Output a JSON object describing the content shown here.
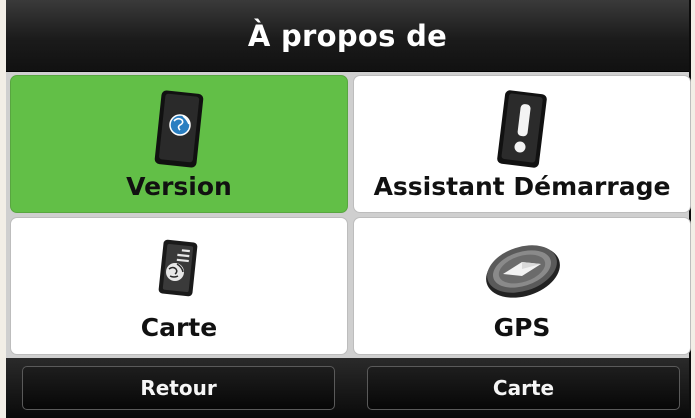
{
  "header": {
    "title": "À propos de"
  },
  "tiles": [
    {
      "label": "Version",
      "icon": "globe-card-icon",
      "active": true
    },
    {
      "label": "Assistant Démarrage",
      "icon": "exclamation-card-icon",
      "active": false
    },
    {
      "label": "Carte",
      "icon": "map-document-icon",
      "active": false
    },
    {
      "label": "GPS",
      "icon": "compass-icon",
      "active": false
    }
  ],
  "footer": {
    "back_label": "Retour",
    "map_label": "Carte"
  },
  "colors": {
    "active_tile": "#62bf47",
    "header_bg": "#1b1b1b",
    "icon_blue": "#2a7fc1"
  }
}
